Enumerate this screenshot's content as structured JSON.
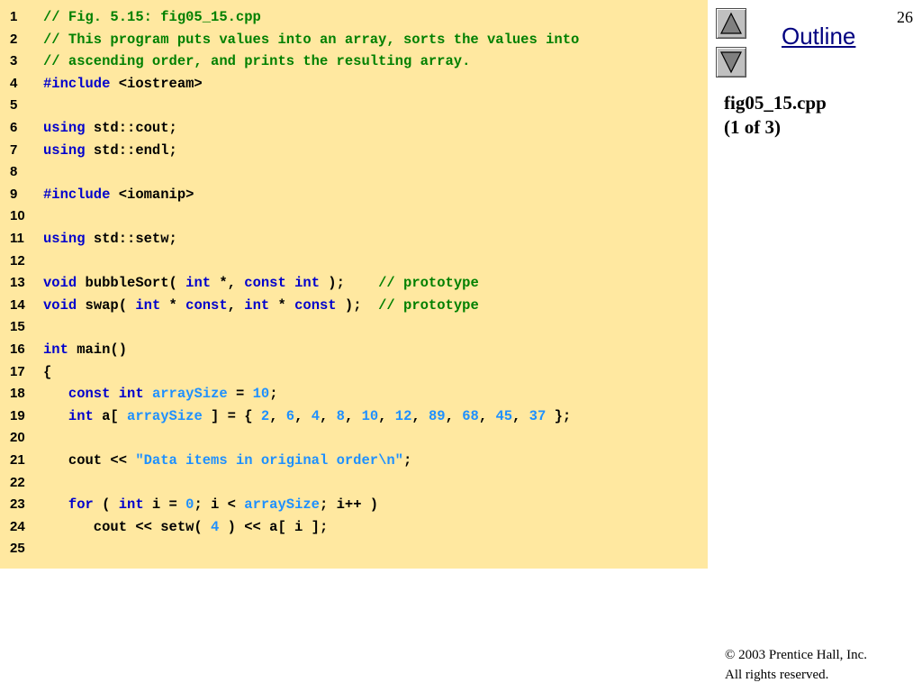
{
  "slide": {
    "page_number": "26",
    "outline_label": "Outline",
    "file_name": "fig05_15.cpp",
    "file_part": "(1 of 3)",
    "copyright_line1": "© 2003 Prentice Hall, Inc.",
    "copyright_line2": "All rights reserved."
  },
  "nav": {
    "prev_icon": "triangle-up-icon",
    "next_icon": "triangle-down-icon"
  },
  "colors": {
    "code_background": "#ffe8a0",
    "comment": "#008000",
    "keyword": "#0000cc",
    "literal": "#1e90ff",
    "plain": "#000000",
    "outline_link": "#000080"
  },
  "code_lines": [
    {
      "number": "1",
      "tokens": [
        {
          "t": "cm",
          "s": "// Fig. 5.15: fig05_15.cpp"
        }
      ]
    },
    {
      "number": "2",
      "tokens": [
        {
          "t": "cm",
          "s": "// This program puts values into an array, sorts the values into"
        }
      ]
    },
    {
      "number": "3",
      "tokens": [
        {
          "t": "cm",
          "s": "// ascending order, and prints the resulting array."
        }
      ]
    },
    {
      "number": "4",
      "tokens": [
        {
          "t": "kw",
          "s": "#include"
        },
        {
          "t": "tx",
          "s": " <iostream>"
        }
      ]
    },
    {
      "number": "5",
      "tokens": []
    },
    {
      "number": "6",
      "tokens": [
        {
          "t": "kw",
          "s": "using"
        },
        {
          "t": "tx",
          "s": " std::cout;"
        }
      ]
    },
    {
      "number": "7",
      "tokens": [
        {
          "t": "kw",
          "s": "using"
        },
        {
          "t": "tx",
          "s": " std::endl;"
        }
      ]
    },
    {
      "number": "8",
      "tokens": []
    },
    {
      "number": "9",
      "tokens": [
        {
          "t": "kw",
          "s": "#include"
        },
        {
          "t": "tx",
          "s": " <iomanip>"
        }
      ]
    },
    {
      "number": "10",
      "tokens": []
    },
    {
      "number": "11",
      "tokens": [
        {
          "t": "kw",
          "s": "using"
        },
        {
          "t": "tx",
          "s": " std::setw;"
        }
      ]
    },
    {
      "number": "12",
      "tokens": []
    },
    {
      "number": "13",
      "tokens": [
        {
          "t": "kw",
          "s": "void"
        },
        {
          "t": "tx",
          "s": " bubbleSort( "
        },
        {
          "t": "kw",
          "s": "int"
        },
        {
          "t": "tx",
          "s": " *, "
        },
        {
          "t": "kw",
          "s": "const"
        },
        {
          "t": "tx",
          "s": " "
        },
        {
          "t": "kw",
          "s": "int"
        },
        {
          "t": "tx",
          "s": " );    "
        },
        {
          "t": "cm",
          "s": "// prototype"
        }
      ]
    },
    {
      "number": "14",
      "tokens": [
        {
          "t": "kw",
          "s": "void"
        },
        {
          "t": "tx",
          "s": " swap( "
        },
        {
          "t": "kw",
          "s": "int"
        },
        {
          "t": "tx",
          "s": " * "
        },
        {
          "t": "kw",
          "s": "const"
        },
        {
          "t": "tx",
          "s": ", "
        },
        {
          "t": "kw",
          "s": "int"
        },
        {
          "t": "tx",
          "s": " * "
        },
        {
          "t": "kw",
          "s": "const"
        },
        {
          "t": "tx",
          "s": " );  "
        },
        {
          "t": "cm",
          "s": "// prototype"
        }
      ]
    },
    {
      "number": "15",
      "tokens": []
    },
    {
      "number": "16",
      "tokens": [
        {
          "t": "kw",
          "s": "int"
        },
        {
          "t": "tx",
          "s": " main()"
        }
      ]
    },
    {
      "number": "17",
      "tokens": [
        {
          "t": "tx",
          "s": "{"
        }
      ]
    },
    {
      "number": "18",
      "tokens": [
        {
          "t": "tx",
          "s": "   "
        },
        {
          "t": "kw",
          "s": "const"
        },
        {
          "t": "tx",
          "s": " "
        },
        {
          "t": "kw",
          "s": "int"
        },
        {
          "t": "tx",
          "s": " "
        },
        {
          "t": "nm",
          "s": "arraySize"
        },
        {
          "t": "tx",
          "s": " = "
        },
        {
          "t": "nm",
          "s": "10"
        },
        {
          "t": "tx",
          "s": ";"
        }
      ]
    },
    {
      "number": "19",
      "tokens": [
        {
          "t": "tx",
          "s": "   "
        },
        {
          "t": "kw",
          "s": "int"
        },
        {
          "t": "tx",
          "s": " a[ "
        },
        {
          "t": "nm",
          "s": "arraySize"
        },
        {
          "t": "tx",
          "s": " ] = { "
        },
        {
          "t": "nm",
          "s": "2"
        },
        {
          "t": "tx",
          "s": ", "
        },
        {
          "t": "nm",
          "s": "6"
        },
        {
          "t": "tx",
          "s": ", "
        },
        {
          "t": "nm",
          "s": "4"
        },
        {
          "t": "tx",
          "s": ", "
        },
        {
          "t": "nm",
          "s": "8"
        },
        {
          "t": "tx",
          "s": ", "
        },
        {
          "t": "nm",
          "s": "10"
        },
        {
          "t": "tx",
          "s": ", "
        },
        {
          "t": "nm",
          "s": "12"
        },
        {
          "t": "tx",
          "s": ", "
        },
        {
          "t": "nm",
          "s": "89"
        },
        {
          "t": "tx",
          "s": ", "
        },
        {
          "t": "nm",
          "s": "68"
        },
        {
          "t": "tx",
          "s": ", "
        },
        {
          "t": "nm",
          "s": "45"
        },
        {
          "t": "tx",
          "s": ", "
        },
        {
          "t": "nm",
          "s": "37"
        },
        {
          "t": "tx",
          "s": " };"
        }
      ]
    },
    {
      "number": "20",
      "tokens": []
    },
    {
      "number": "21",
      "tokens": [
        {
          "t": "tx",
          "s": "   cout << "
        },
        {
          "t": "st",
          "s": "\"Data items in original order\\n\""
        },
        {
          "t": "tx",
          "s": ";"
        }
      ]
    },
    {
      "number": "22",
      "tokens": []
    },
    {
      "number": "23",
      "tokens": [
        {
          "t": "tx",
          "s": "   "
        },
        {
          "t": "kw",
          "s": "for"
        },
        {
          "t": "tx",
          "s": " ( "
        },
        {
          "t": "kw",
          "s": "int"
        },
        {
          "t": "tx",
          "s": " i = "
        },
        {
          "t": "nm",
          "s": "0"
        },
        {
          "t": "tx",
          "s": "; i < "
        },
        {
          "t": "nm",
          "s": "arraySize"
        },
        {
          "t": "tx",
          "s": "; i++ )"
        }
      ]
    },
    {
      "number": "24",
      "tokens": [
        {
          "t": "tx",
          "s": "      cout << setw( "
        },
        {
          "t": "nm",
          "s": "4"
        },
        {
          "t": "tx",
          "s": " ) << a[ i ];"
        }
      ]
    },
    {
      "number": "25",
      "tokens": []
    }
  ]
}
